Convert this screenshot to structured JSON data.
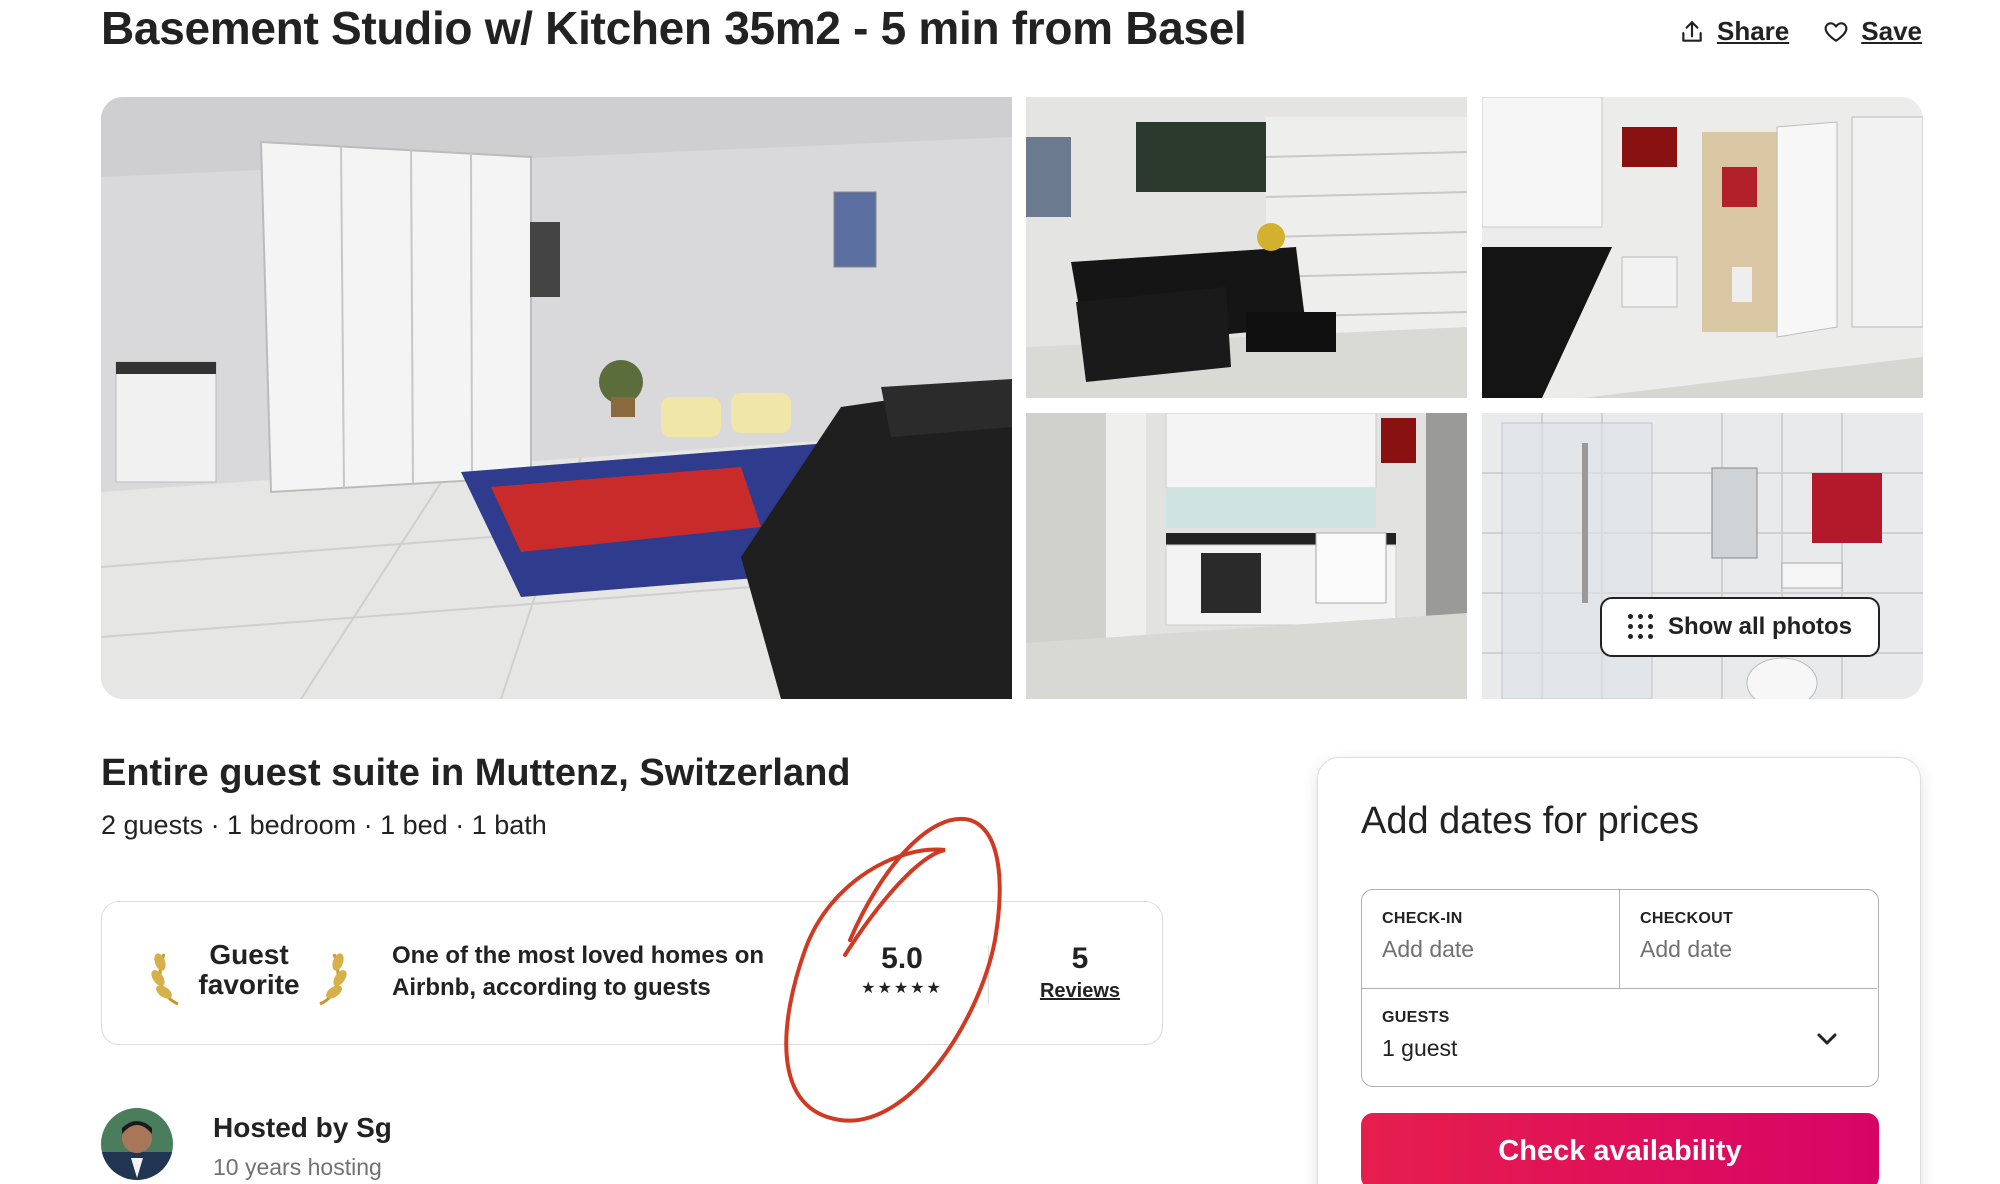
{
  "listing": {
    "title": "Basement Studio w/ Kitchen 35m2 - 5 min from Basel",
    "share_label": "Share",
    "save_label": "Save"
  },
  "gallery": {
    "show_all_label": "Show all photos"
  },
  "summary": {
    "subtitle": "Entire guest suite in Muttenz, Switzerland",
    "details": "2 guests · 1 bedroom · 1 bed · 1 bath"
  },
  "guest_favorite": {
    "label_line1": "Guest",
    "label_line2": "favorite",
    "description": "One of the most loved homes on Airbnb, according to guests",
    "rating": "5.0",
    "stars": "★★★★★",
    "reviews_count": "5",
    "reviews_label": "Reviews"
  },
  "host": {
    "name": "Hosted by Sg",
    "years": "10 years hosting"
  },
  "booking": {
    "title": "Add dates for prices",
    "checkin_label": "CHECK-IN",
    "checkin_value": "Add date",
    "checkout_label": "CHECKOUT",
    "checkout_value": "Add date",
    "guests_label": "GUESTS",
    "guests_value": "1 guest",
    "cta_label": "Check availability"
  },
  "colors": {
    "brand_gradient_start": "#e61e4d",
    "brand_gradient_end": "#d70466",
    "annotation": "#d03a22"
  }
}
